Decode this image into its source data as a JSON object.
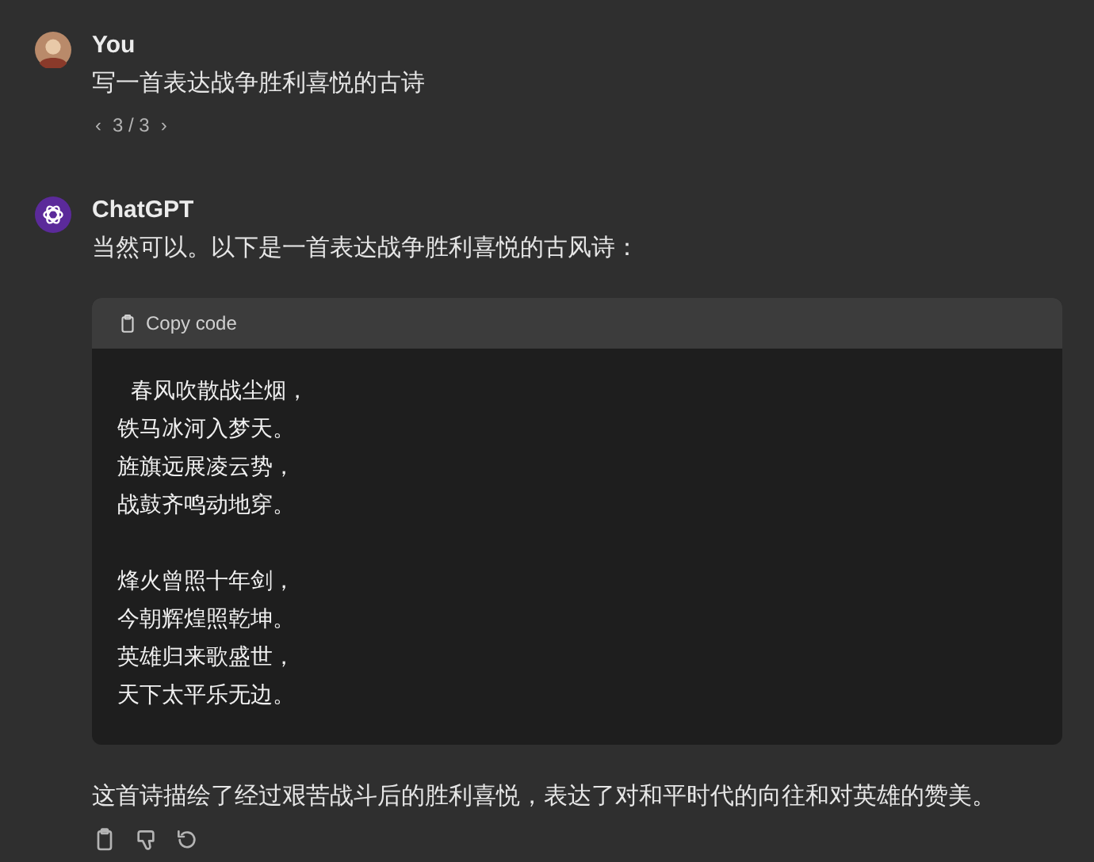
{
  "messages": [
    {
      "kind": "user",
      "author": "You",
      "text": "写一首表达战争胜利喜悦的古诗",
      "pager": {
        "prev": "‹",
        "label": "3 / 3",
        "next": "›"
      }
    },
    {
      "kind": "assistant",
      "author": "ChatGPT",
      "intro": "当然可以。以下是一首表达战争胜利喜悦的古风诗：",
      "code_block": {
        "copy_label": "Copy code",
        "stanzas": [
          [
            " 春风吹散战尘烟，",
            "铁马冰河入梦天。",
            "旌旗远展凌云势，",
            "战鼓齐鸣动地穿。"
          ],
          [
            "烽火曾照十年剑，",
            "今朝辉煌照乾坤。",
            "英雄归来歌盛世，",
            "天下太平乐无边。"
          ]
        ]
      },
      "outro": "这首诗描绘了经过艰苦战斗后的胜利喜悦，表达了对和平时代的向往和对英雄的赞美。"
    }
  ]
}
